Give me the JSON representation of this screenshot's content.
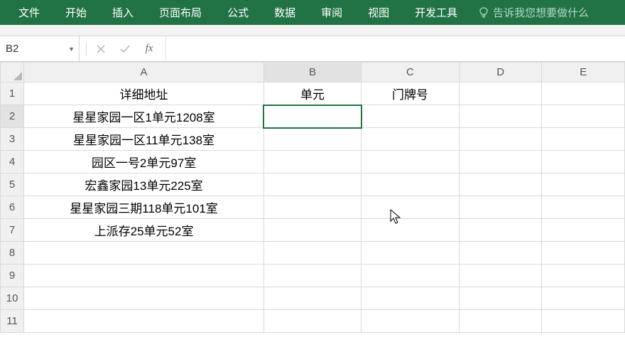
{
  "ribbon": {
    "tabs": [
      "文件",
      "开始",
      "插入",
      "页面布局",
      "公式",
      "数据",
      "审阅",
      "视图",
      "开发工具"
    ],
    "tell_me": "告诉我您想要做什么"
  },
  "formula_bar": {
    "name_box": "B2",
    "fx_label": "fx",
    "formula": ""
  },
  "colors": {
    "ribbon_bg": "#217346",
    "selection": "#217346"
  },
  "sheet": {
    "active_cell": "B2",
    "columns": [
      "A",
      "B",
      "C",
      "D",
      "E"
    ],
    "row_count": 11,
    "cells": {
      "A1": "详细地址",
      "B1": "单元",
      "C1": "门牌号",
      "A2": "星星家园一区1单元1208室",
      "A3": "星星家园一区11单元138室",
      "A4": "园区一号2单元97室",
      "A5": "宏鑫家园13单元225室",
      "A6": "星星家园三期118单元101室",
      "A7": "上派存25单元52室"
    }
  }
}
